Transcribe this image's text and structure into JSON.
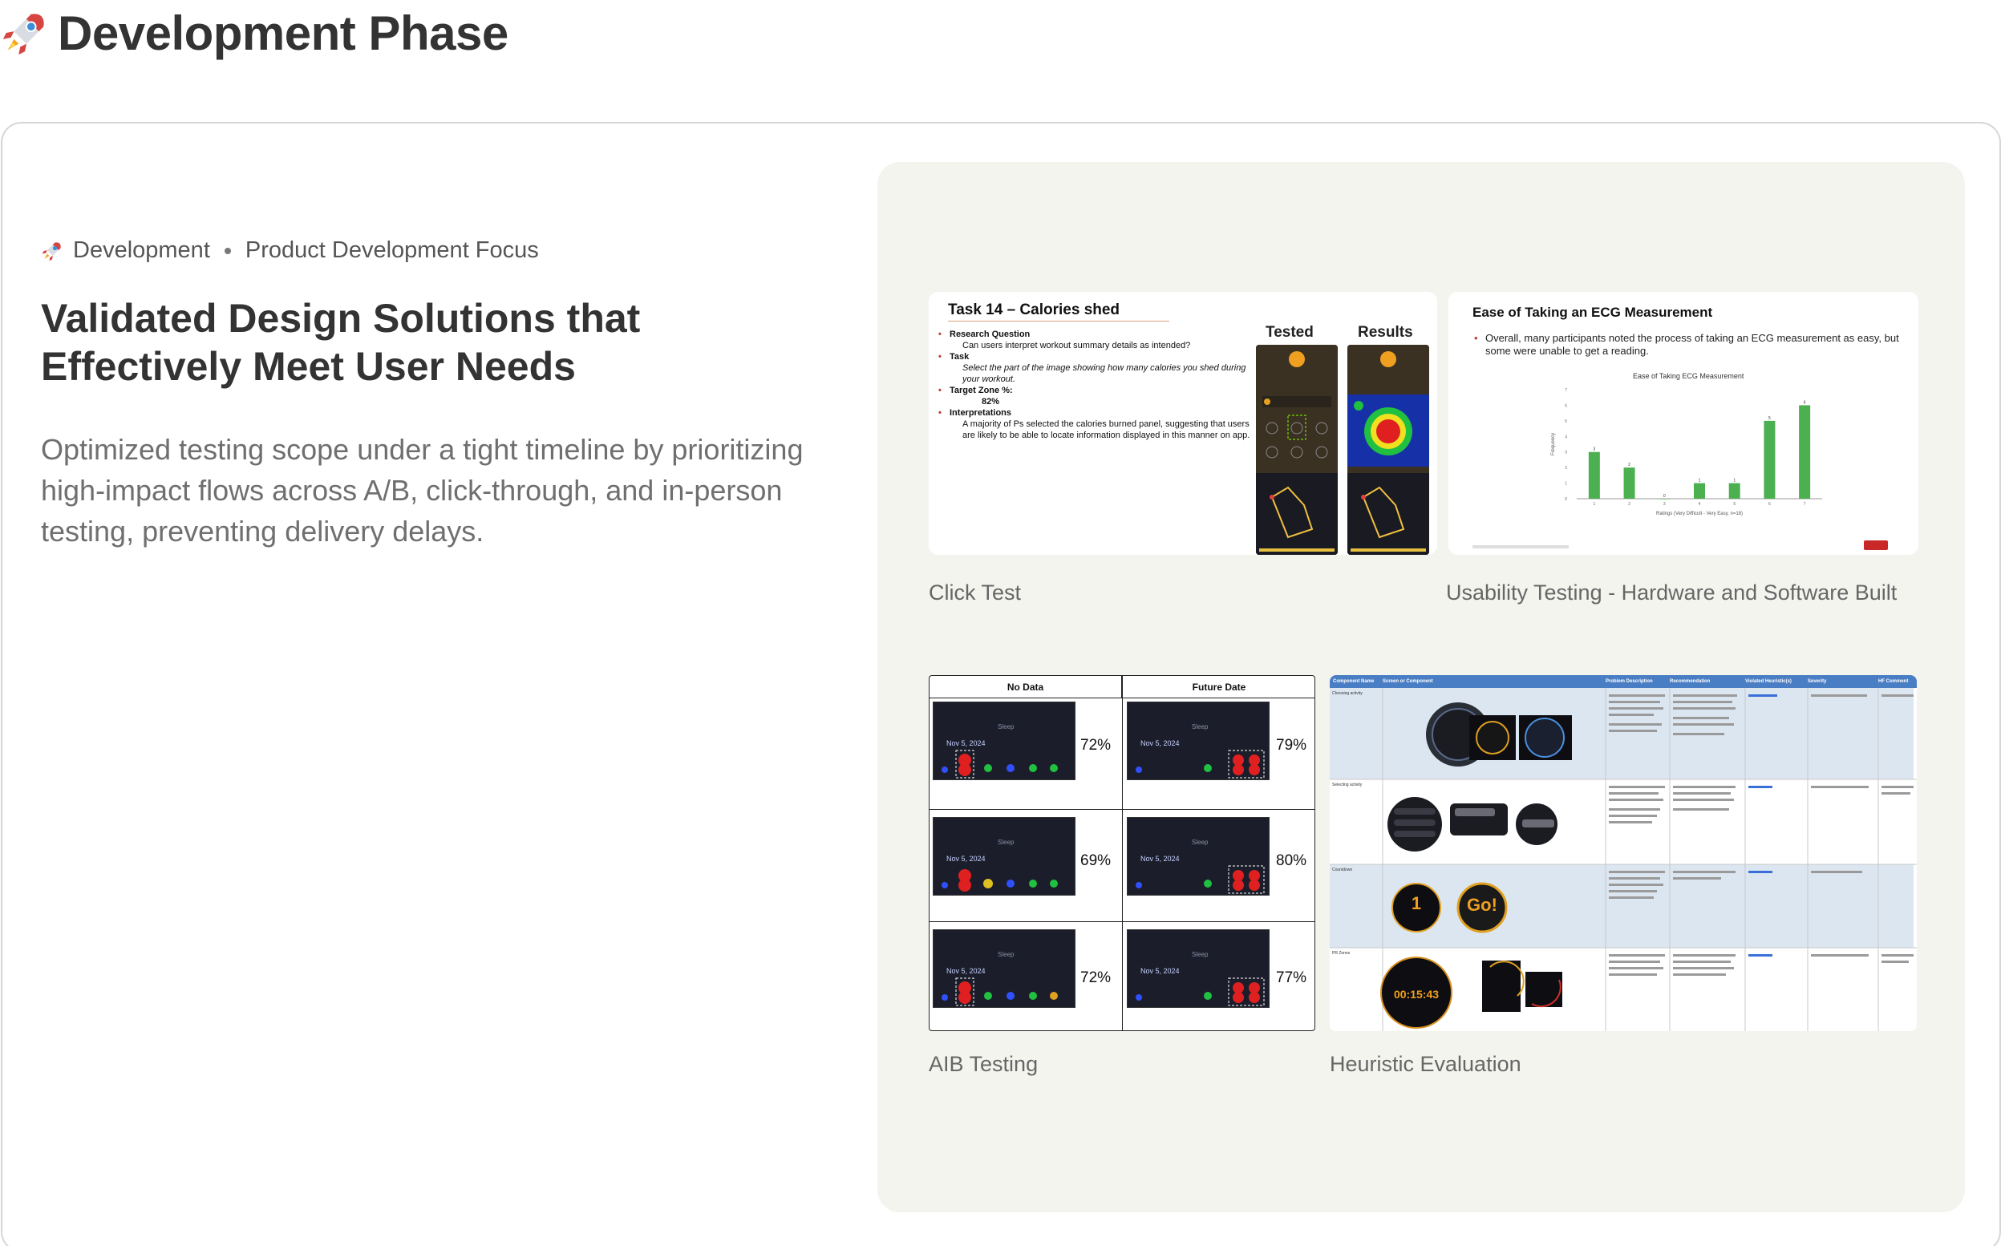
{
  "page": {
    "title": "Development Phase"
  },
  "breadcrumb": {
    "section": "Development",
    "focus": "Product Development Focus"
  },
  "headline": "Validated Design Solutions that Effectively Meet User Needs",
  "description": "Optimized testing scope under a tight timeline by prioritizing high-impact flows across A/B, click-through, and in-person testing, preventing delivery delays.",
  "click_test": {
    "caption": "Click Test",
    "slide_title": "Task 14 – Calories shed",
    "q_label": "Research Question",
    "q_text": "Can users interpret workout summary details as intended?",
    "task_label": "Task",
    "task_text": "Select the part of the image showing how many calories you shed during your workout.",
    "zone_label": "Target Zone %:",
    "zone_value": "82%",
    "interp_label": "Interpretations",
    "interp_text": "A majority of Ps selected the calories burned panel, suggesting that users are likely to be able to locate information displayed in this manner on app.",
    "col_tested": "Tested",
    "col_results": "Results"
  },
  "usability": {
    "caption": "Usability Testing - Hardware and Software Built",
    "slide_title": "Ease of Taking an ECG Measurement",
    "bullet": "Overall, many participants noted the process of taking an ECG measurement as easy, but some were unable to get a reading."
  },
  "chart_data": {
    "type": "bar",
    "title": "Ease of Taking ECG Measurement",
    "xlabel": "Ratings (Very Difficult - Very Easy, n=18)",
    "ylabel": "Frequency",
    "categories": [
      "1",
      "2",
      "3",
      "4",
      "5",
      "6",
      "7"
    ],
    "values": [
      3,
      2,
      0,
      1,
      1,
      5,
      6
    ],
    "ylim": [
      0,
      7
    ],
    "color": "#4caf50"
  },
  "ab_testing": {
    "caption": "AIB Testing",
    "col_a": "No Data",
    "col_b": "Future Date",
    "rows": [
      {
        "a_pct": "72%",
        "b_pct": "79%",
        "date": "Nov 5, 2024"
      },
      {
        "a_pct": "69%",
        "b_pct": "80%",
        "date": "Nov 5, 2024"
      },
      {
        "a_pct": "72%",
        "b_pct": "77%",
        "date": "Nov 5, 2024"
      }
    ],
    "screen_label": "Sleep"
  },
  "heuristic": {
    "caption": "Heuristic Evaluation",
    "headers": [
      "Component Name",
      "Screen or Component",
      "Problem Description",
      "Recommendation",
      "Violated Heuristic(s)",
      "Severity",
      "HF Comment"
    ],
    "rows": [
      "Choosing activity",
      "Selecting activity",
      "Countdown",
      "PR Zones"
    ],
    "countdown_number": "1",
    "go_label": "Go!",
    "timer": "00:15:43"
  },
  "colors": {
    "accent_green": "#4caf50",
    "panel_bg": "#f4f4ef",
    "table_blue": "#dce6f1",
    "header_blue": "#4a7ec4"
  }
}
